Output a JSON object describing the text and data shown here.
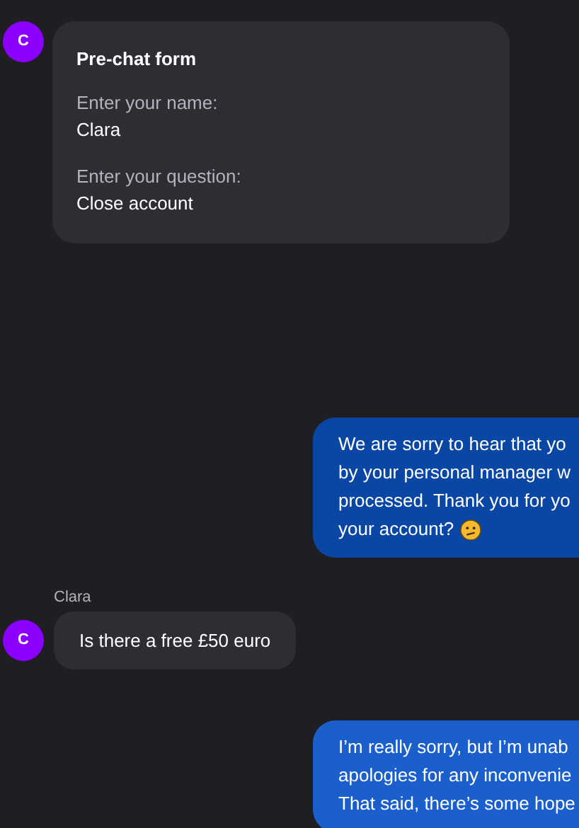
{
  "messages": [
    {
      "kind": "form",
      "avatar": "C",
      "title": "Pre-chat form",
      "fields": [
        {
          "label": "Enter your name:",
          "value": "Clara"
        },
        {
          "label": "Enter your question:",
          "value": "Close account"
        }
      ]
    },
    {
      "kind": "agent",
      "color": "#0a47a5",
      "lines": [
        "We are sorry to hear that yo",
        "by your personal manager w",
        "processed. Thank you for yo",
        "your account?"
      ],
      "emoji": true
    },
    {
      "kind": "visitor",
      "sender": "Clara",
      "avatar": "C",
      "text": "Is there a free £50 euro"
    },
    {
      "kind": "agent",
      "color": "#1a5fcc",
      "lines": [
        "I’m really sorry, but I’m unab",
        "apologies for any inconvenie",
        "That said, there’s some hope"
      ],
      "emoji": false
    }
  ]
}
